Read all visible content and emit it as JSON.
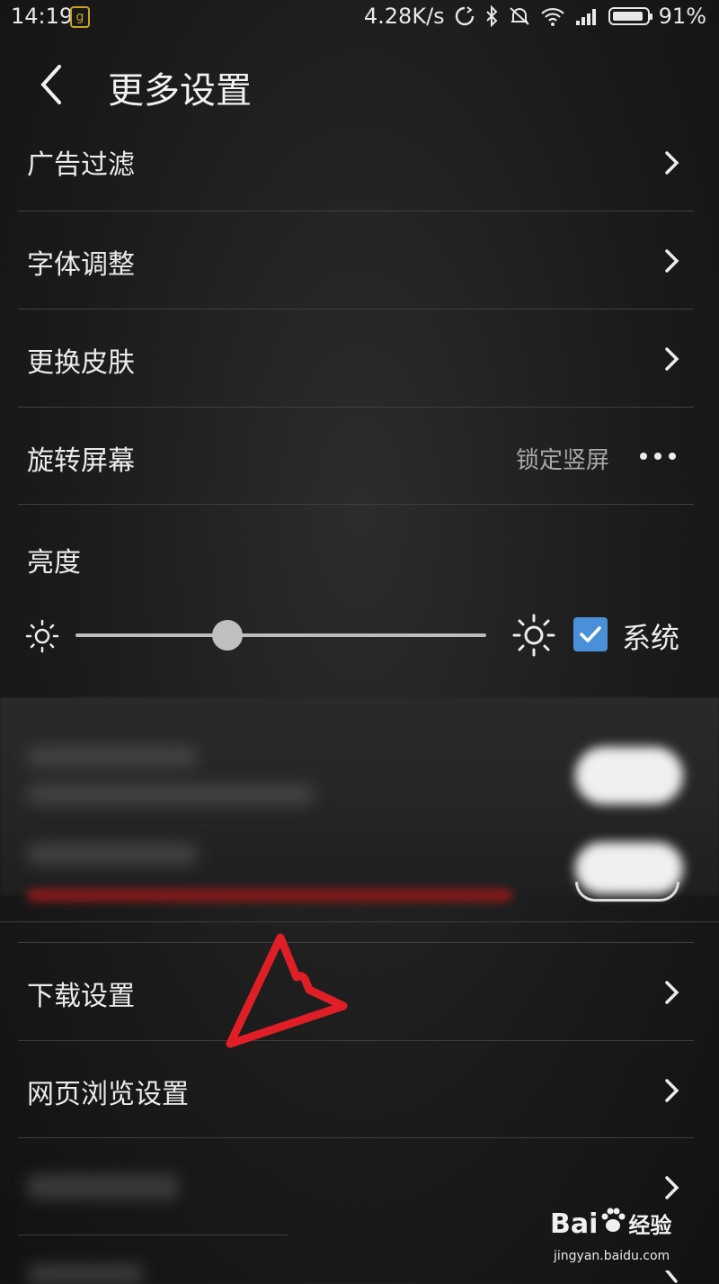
{
  "status_bar": {
    "time": "14:19",
    "app_icon": "g",
    "net_speed": "4.28K/s",
    "battery": "91%"
  },
  "header": {
    "title": "更多设置"
  },
  "items": {
    "ad_filter": "广告过滤",
    "font_adjust": "字体调整",
    "change_skin": "更换皮肤",
    "rotate_screen": "旋转屏幕",
    "rotate_value": "锁定竖屏",
    "brightness": "亮度",
    "system_label": "系统",
    "download_settings": "下载设置",
    "web_browse_settings": "网页浏览设置"
  },
  "brightness": {
    "level": 0.37,
    "system_checked": true
  },
  "colors": {
    "checkbox": "#4a90d9",
    "annotation": "#e01e25"
  },
  "watermark": {
    "logo": "Bai",
    "logo_suffix": "经验",
    "url": "jingyan.baidu.com"
  }
}
